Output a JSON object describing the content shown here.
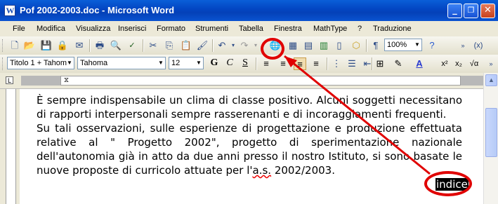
{
  "window": {
    "title": "Pof 2002-2003.doc - Microsoft Word",
    "minimize": "_",
    "restore": "❐",
    "close": "✕",
    "app_icon": "W"
  },
  "menu": [
    "File",
    "Modifica",
    "Visualizza",
    "Inserisci",
    "Formato",
    "Strumenti",
    "Tabella",
    "Finestra",
    "MathType",
    "?",
    "Traduzione"
  ],
  "toolbar1": {
    "zoom": "100%",
    "icons": [
      "new-icon",
      "open-icon",
      "save-icon",
      "permission-icon",
      "mail-icon",
      "print-icon",
      "print-preview-icon",
      "spelling-icon",
      "research-icon",
      "cut-icon",
      "copy-icon",
      "paste-icon",
      "format-painter-icon",
      "undo-icon",
      "redo-icon",
      "hyperlink-icon",
      "tables-borders-icon",
      "insert-table-icon",
      "insert-excel-icon",
      "columns-icon",
      "drawing-icon",
      "show-hide-icon",
      "help-icon"
    ]
  },
  "toolbar2": {
    "style": "Titolo 1 + Tahom",
    "font": "Tahoma",
    "size": "12",
    "bold": "G",
    "italic": "C",
    "underline": "S",
    "superscript": "x²",
    "subscript": "x₂"
  },
  "document": {
    "line1": "È sempre indispensabile un clima di classe positivo. Alcuni soggetti necessitano di rapporti interpersonali sempre rasserenanti e di incoraggiamenti frequenti.",
    "line2_pre": "Su tali osservazioni, sulle esperienze di progettazione e produzione effettuata relative al \" Progetto 2002\", progetto di sperimentazione nazionale dell'autonomia già in atto da due anni presso il nostro Istituto, si sono basate le nuove proposte di curricolo attuate per l'",
    "line2_err": "a.s.",
    "line2_post": " 2002/2003.",
    "selected_word": "indice"
  },
  "annotation_color": "#e00000"
}
